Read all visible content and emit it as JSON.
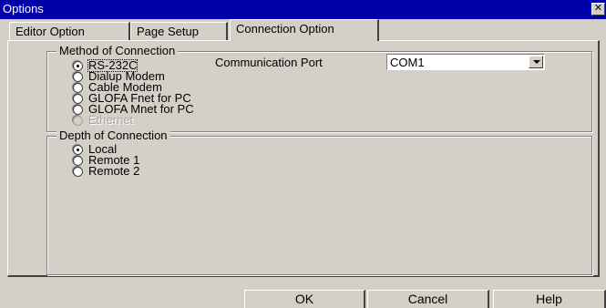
{
  "window": {
    "title": "Options",
    "close_symbol": "✕"
  },
  "tabs": [
    {
      "label": "Editor Option",
      "active": false
    },
    {
      "label": "Page Setup",
      "active": false
    },
    {
      "label": "Connection Option",
      "active": true
    }
  ],
  "method_group": {
    "title": "Method of Connection",
    "options": [
      {
        "label": "RS-232C",
        "checked": true,
        "enabled": true
      },
      {
        "label": "Dialup Modem",
        "checked": false,
        "enabled": true
      },
      {
        "label": "Cable Modem",
        "checked": false,
        "enabled": true
      },
      {
        "label": "GLOFA Fnet for PC",
        "checked": false,
        "enabled": true
      },
      {
        "label": "GLOFA Mnet for PC",
        "checked": false,
        "enabled": true
      },
      {
        "label": "Ethernet",
        "checked": false,
        "enabled": false
      }
    ],
    "port_label": "Communication Port",
    "port_value": "COM1"
  },
  "depth_group": {
    "title": "Depth of Connection",
    "options": [
      {
        "label": "Local",
        "checked": true
      },
      {
        "label": "Remote 1",
        "checked": false
      },
      {
        "label": "Remote 2",
        "checked": false
      }
    ]
  },
  "buttons": {
    "ok": "OK",
    "cancel": "Cancel",
    "help": "Help"
  }
}
